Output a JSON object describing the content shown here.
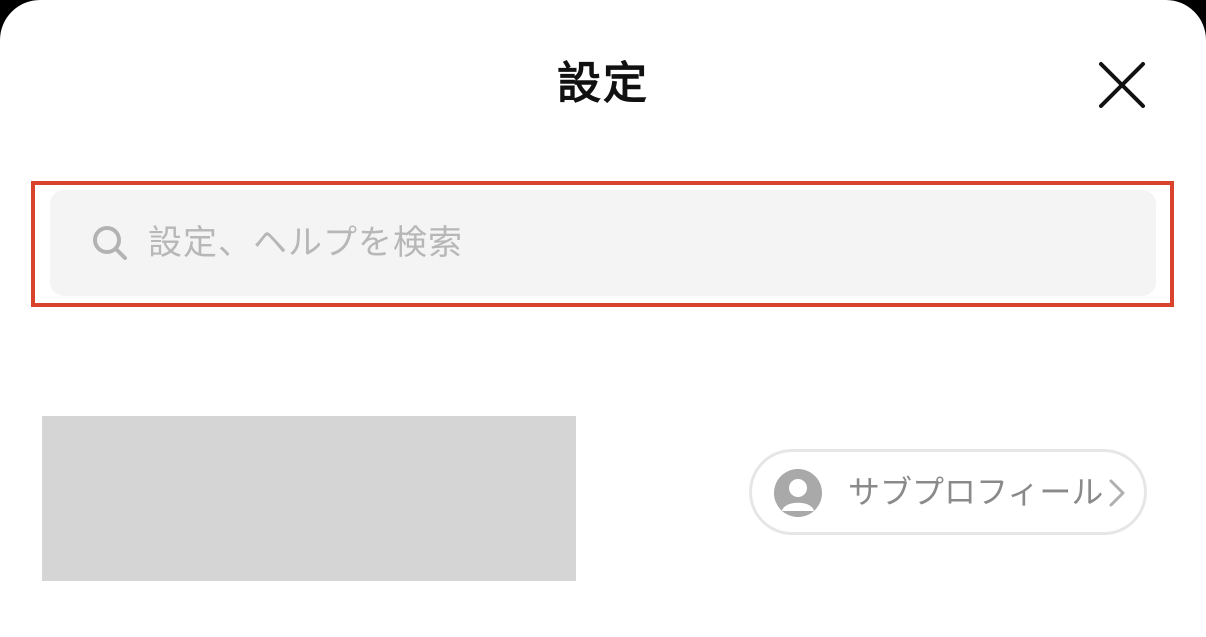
{
  "header": {
    "title": "設定",
    "close_icon": "close-icon"
  },
  "search": {
    "placeholder": "設定、ヘルプを検索",
    "icon": "search-icon",
    "highlight_color": "#d9432b"
  },
  "profile": {
    "subprofile_label": "サブプロフィール",
    "avatar_icon": "avatar-icon",
    "chevron_icon": "chevron-right-icon"
  },
  "colors": {
    "background": "#ffffff",
    "field_bg": "#f4f4f4",
    "placeholder": "#b7b7b7",
    "banner_placeholder": "#d5d5d5"
  }
}
